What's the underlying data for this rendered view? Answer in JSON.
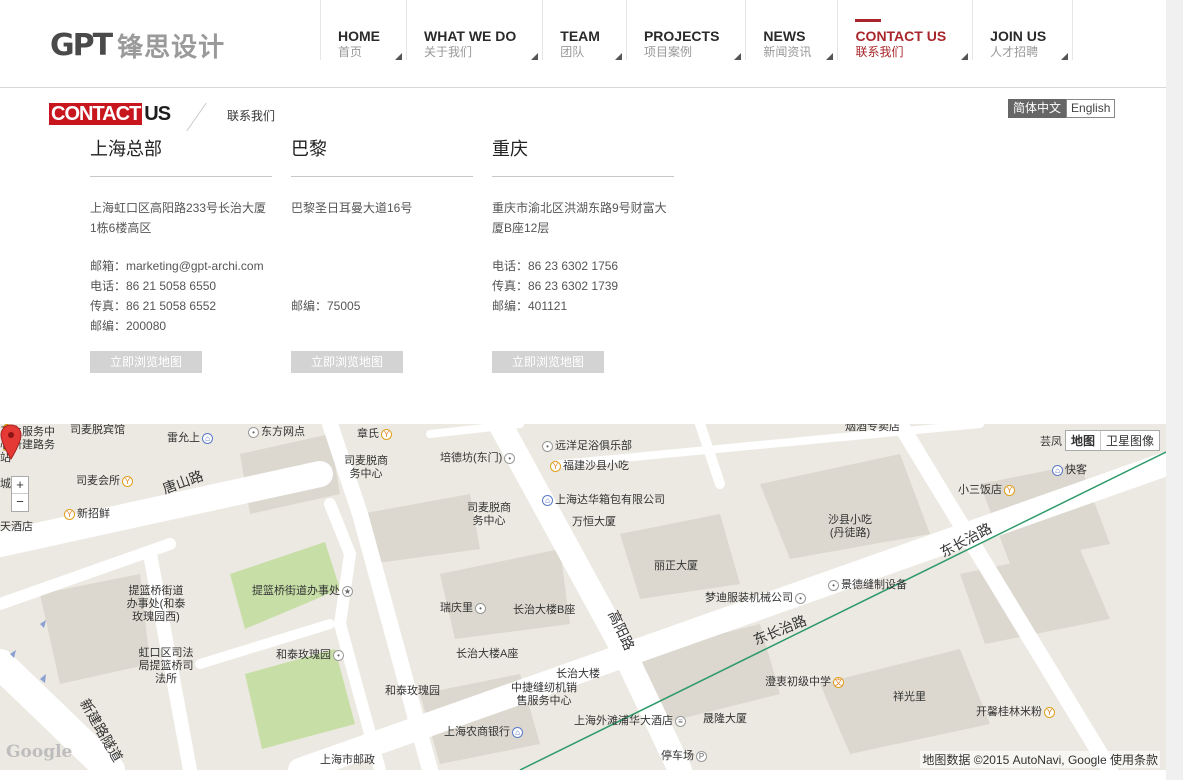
{
  "brand": {
    "mark": "GPT",
    "cn": "锋思设计"
  },
  "nav": [
    {
      "en": "HOME",
      "cn": "首页"
    },
    {
      "en": "WHAT WE DO",
      "cn": "关于我们"
    },
    {
      "en": "TEAM",
      "cn": "团队"
    },
    {
      "en": "PROJECTS",
      "cn": "项目案例"
    },
    {
      "en": "NEWS",
      "cn": "新闻资讯"
    },
    {
      "en": "CONTACT US",
      "cn": "联系我们"
    },
    {
      "en": "JOIN US",
      "cn": "人才招聘"
    }
  ],
  "active_nav": "CONTACT US",
  "accent_color": "#a8262b",
  "contact": {
    "red": "CONTACT",
    "black": "US",
    "cn": "联系我们"
  },
  "lang": {
    "zh": "简体中文",
    "en": "English"
  },
  "offices": [
    {
      "city": "上海总部",
      "address": "上海虹口区高阳路233号长治大厦1栋6楼高区",
      "email": "邮箱：marketing@gpt-archi.com",
      "phone": "电话：86 21 5058 6550",
      "fax": "传真：86 21 5058 6552",
      "zip": "邮编：200080",
      "button": "立即浏览地图"
    },
    {
      "city": "巴黎",
      "address": "巴黎圣日耳曼大道16号",
      "email": "",
      "phone": "",
      "fax": "邮编：75005",
      "zip": "",
      "button": "立即浏览地图"
    },
    {
      "city": "重庆",
      "address": "重庆市渝北区洪湖东路9号财富大厦B座12层",
      "email": "电话：86 23 6302 1756",
      "phone": "传真：86 23 6302 1739",
      "fax": "邮编：401121",
      "zip": "",
      "button": "立即浏览地图"
    }
  ],
  "map": {
    "type_map": "地图",
    "type_sat": "卫星图像",
    "zoom_in": "+",
    "zoom_out": "−",
    "logo": "Google",
    "attribution": "地图数据 ©2015 AutoNavi, Google   使用条款",
    "labels": {
      "l1": "司麦脱宾馆",
      "l2": "雷允上",
      "l3": "东方网点",
      "l4": "章氏",
      "l5": "培德坊(东门)",
      "l6": "远洋足浴俱乐部",
      "l7": "福建沙县小吃",
      "l8": "司麦脱商务中心",
      "l9": "司麦会所",
      "l10": "唐山路",
      "l11": "新招鲜",
      "l12": "上海达华箱包有限公司",
      "l13": "司麦脱商务中心",
      "l14": "万恒大厦",
      "l15": "烟酒专卖店",
      "l16": "芸凤",
      "l17": "快客",
      "l18": "小三饭店",
      "l19": "沙县小吃(丹徒路)",
      "l20": "东长治路",
      "l21": "丽正大厦",
      "l22": "景德缝制设备",
      "l23": "梦迪服装机械公司",
      "l24": "提篮桥街道办事处(和泰玫瑰园西)",
      "l25": "提篮桥街道办事处",
      "l26": "瑞庆里",
      "l27": "长治大楼B座",
      "l28": "高阳路",
      "l29": "东长治路",
      "l30": "虹口区司法局提篮桥司法所",
      "l31": "和泰玫瑰园",
      "l32": "长治大楼A座",
      "l33": "长治大楼",
      "l34": "中捷缝纫机销售服务中心",
      "l35": "和泰玫瑰园",
      "l36": "澄衷初级中学",
      "l37": "祥光里",
      "l38": "开馨桂林米粉",
      "l39": "上海外滩浦华大酒店",
      "l40": "晟隆大厦",
      "l41": "上海农商银行",
      "l42": "停车场",
      "l43": "上海市邮政",
      "l44": "新建路隧道",
      "l45": "卫生服务中心新建路务站",
      "l46": "城",
      "l47": "天酒店"
    }
  }
}
